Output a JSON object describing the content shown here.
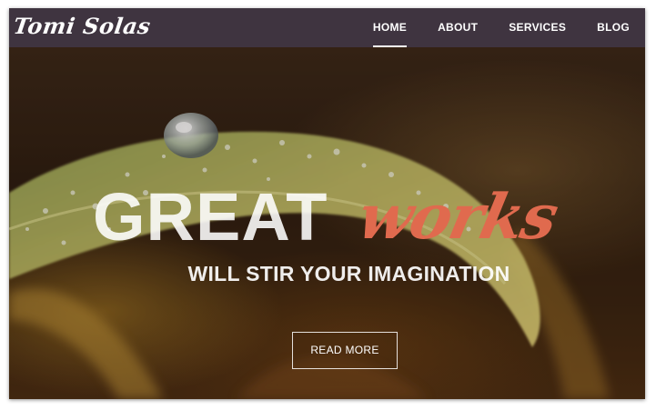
{
  "site": {
    "logo_text": "Tomi Solas"
  },
  "nav": {
    "items": [
      {
        "label": "HOME",
        "active": true
      },
      {
        "label": "ABOUT",
        "active": false
      },
      {
        "label": "SERVICES",
        "active": false
      },
      {
        "label": "BLOG",
        "active": false
      }
    ]
  },
  "hero": {
    "headline_main": "GREAT",
    "headline_script": "works",
    "subheadline": "WILL STIR YOUR IMAGINATION",
    "cta_label": "READ MORE",
    "accent_color": "#e06a4e",
    "nav_background": "#3f3440"
  }
}
